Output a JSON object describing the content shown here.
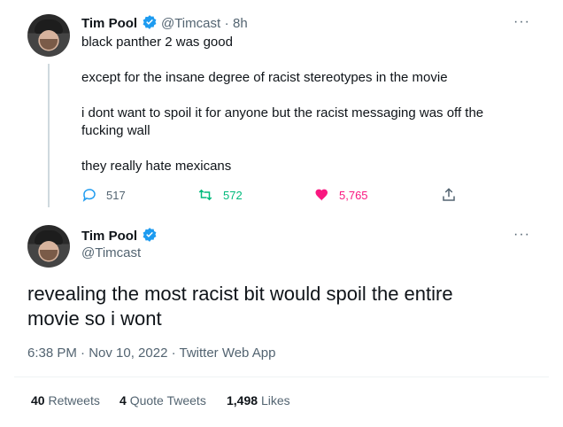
{
  "tweet1": {
    "name": "Tim Pool",
    "handle": "@Timcast",
    "sep": "·",
    "time": "8h",
    "lines": [
      "black panther 2 was good",
      "except for the insane degree of racist stereotypes in the movie",
      "i dont want to spoil it for anyone but the racist messaging was off the",
      "fucking wall",
      "they really hate mexicans"
    ],
    "replies": "517",
    "retweets": "572",
    "likes": "5,765",
    "more": "···"
  },
  "tweet2": {
    "name": "Tim Pool",
    "handle": "@Timcast",
    "more": "···",
    "text_line1": "revealing the most racist bit would spoil the entire",
    "text_line2": "movie so i wont",
    "meta": "6:38 PM · Nov 10, 2022 · Twitter Web App",
    "stats": {
      "retweets_count": "40",
      "retweets_label": "Retweets",
      "quotes_count": "4",
      "quotes_label": "Quote Tweets",
      "likes_count": "1,498",
      "likes_label": "Likes"
    }
  },
  "colors": {
    "verified": "#1d9bf0",
    "like": "#f91880",
    "retweet": "#00ba7c",
    "reply": "#1d9bf0"
  }
}
